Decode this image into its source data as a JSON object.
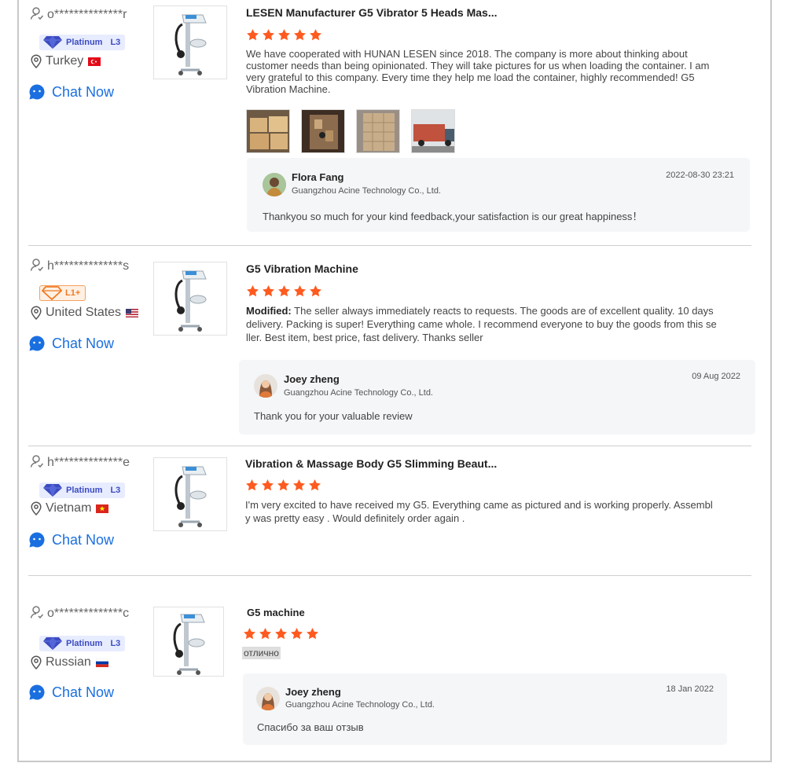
{
  "colors": {
    "accent": "#1a6fe0",
    "star": "#ff5a1f",
    "platinum": "#3b4cc0",
    "lplus": "#f07a22"
  },
  "reviews": [
    {
      "buyer": "o**************r",
      "badge_label": "Platinum",
      "badge_tier": "L3",
      "country": "Turkey",
      "chat_label": "Chat Now",
      "product_title": "LESEN Manufacturer G5 Vibrator 5 Heads Mas...",
      "rating": 5,
      "text": "We have cooperated with HUNAN LESEN since 2018. The company is more about thinking about customer needs than being opinionated. They will take pictures for us when loading the container. I am very grateful to this company. Every time they help me load the container, highly recommended! G5 Vibration Machine.",
      "photos": [
        "boxes-photo",
        "loading-photo",
        "container-photo",
        "truck-photo"
      ],
      "reply": {
        "name": "Flora Fang",
        "company": "Guangzhou Acine Technology Co., Ltd.",
        "date": "2022-08-30 23:21",
        "message": "Thankyou so much for your kind feedback,your satisfaction is our great happiness！"
      }
    },
    {
      "buyer": "h**************s",
      "badge_label": "L1+",
      "country": "United States",
      "chat_label": "Chat Now",
      "product_title": "G5 Vibration Machine",
      "rating": 5,
      "text_prefix": "Modified:",
      "text": " The seller always immediately reacts to requests. The goods are of excellent quality. 10 days delivery. Packing is super! Everything came whole. I recommend everyone to buy the goods from this seller. Best item, best price, fast delivery. Thanks seller",
      "reply": {
        "name": "Joey zheng",
        "company": "Guangzhou Acine Technology Co., Ltd.",
        "date": "09 Aug 2022",
        "message": "Thank you for your valuable review"
      }
    },
    {
      "buyer": "h**************e",
      "badge_label": "Platinum",
      "badge_tier": "L3",
      "country": "Vietnam",
      "chat_label": "Chat Now",
      "product_title": "Vibration & Massage Body G5 Slimming Beaut...",
      "rating": 5,
      "text": "I'm very excited to have received my G5. Everything came as pictured and is working properly. Assembly was pretty easy . Would definitely order again ."
    },
    {
      "buyer": "o**************c",
      "badge_label": "Platinum",
      "badge_tier": "L3",
      "country": "Russian",
      "chat_label": "Chat Now",
      "product_title": "G5 machine",
      "rating": 5,
      "text": "отлично",
      "reply": {
        "name": "Joey zheng",
        "company": "Guangzhou Acine Technology Co., Ltd.",
        "date": "18 Jan 2022",
        "message": "Спасибо за ваш отзыв"
      }
    }
  ]
}
